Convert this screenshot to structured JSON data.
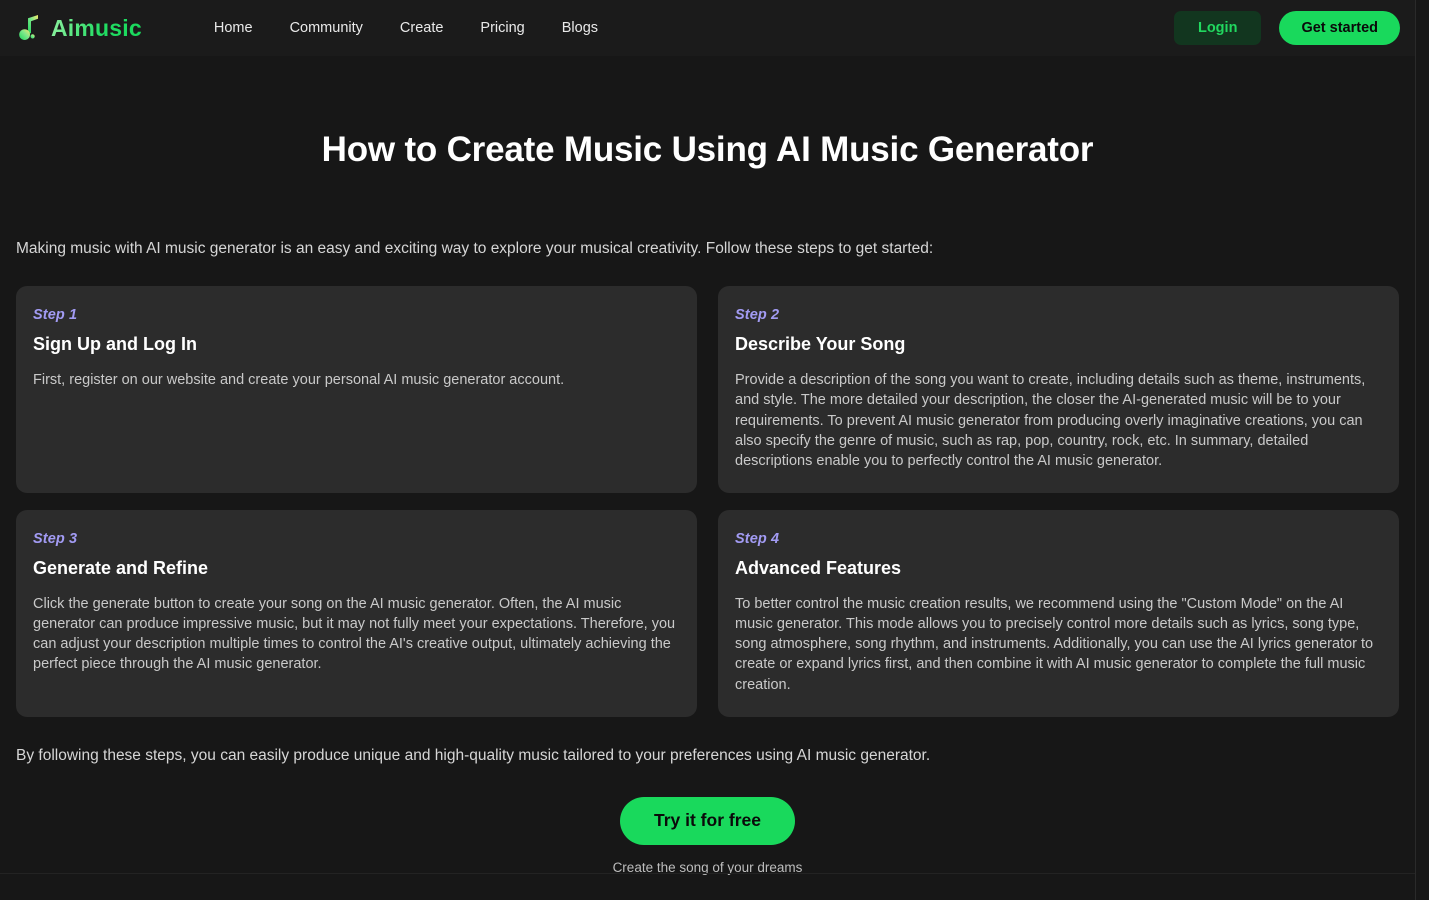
{
  "brand": {
    "name": "Aimusic",
    "logo_icon": "music-note-icon",
    "gradient_from": "#8ff0a0",
    "gradient_to": "#19d95c"
  },
  "theme": {
    "page_background": "#171717",
    "header_background": "#1b1b1b",
    "card_background": "#2c2c2c",
    "accent_green": "#19d95c",
    "login_background": "#12361f",
    "login_text": "#21d85f",
    "step_label_color": "#a29bf3",
    "heading_color": "#ffffff",
    "body_text_color": "#c9c9c9"
  },
  "header": {
    "nav": [
      {
        "label": "Home"
      },
      {
        "label": "Community"
      },
      {
        "label": "Create"
      },
      {
        "label": "Pricing"
      },
      {
        "label": "Blogs"
      }
    ],
    "login_label": "Login",
    "get_started_label": "Get started"
  },
  "main": {
    "title": "How to Create Music Using AI Music Generator",
    "intro": "Making music with AI music generator is an easy and exciting way to explore your musical creativity. Follow these steps to get started:",
    "steps": [
      {
        "label": "Step 1",
        "title": "Sign Up and Log In",
        "body": "First, register on our website and create your personal AI music generator account."
      },
      {
        "label": "Step 2",
        "title": "Describe Your Song",
        "body": "Provide a description of the song you want to create, including details such as theme, instruments, and style. The more detailed your description, the closer the AI-generated music will be to your requirements. To prevent AI music generator from producing overly imaginative creations, you can also specify the genre of music, such as rap, pop, country, rock, etc. In summary, detailed descriptions enable you to perfectly control the AI music generator."
      },
      {
        "label": "Step 3",
        "title": "Generate and Refine",
        "body": "Click the generate button to create your song on the AI music generator. Often, the AI music generator can produce impressive music, but it may not fully meet your expectations. Therefore, you can adjust your description multiple times to control the AI's creative output, ultimately achieving the perfect piece through the AI music generator."
      },
      {
        "label": "Step 4",
        "title": "Advanced Features",
        "body": "To better control the music creation results, we recommend using the \"Custom Mode\" on the AI music generator. This mode allows you to precisely control more details such as lyrics, song type, song atmosphere, song rhythm, and instruments. Additionally, you can use the AI lyrics generator to create or expand lyrics first, and then combine it with AI music generator to complete the full music creation."
      }
    ],
    "outro": "By following these steps, you can easily produce unique and high-quality music tailored to your preferences using AI music generator.",
    "cta_label": "Try it for free",
    "cta_subtext": "Create the song of your dreams"
  }
}
